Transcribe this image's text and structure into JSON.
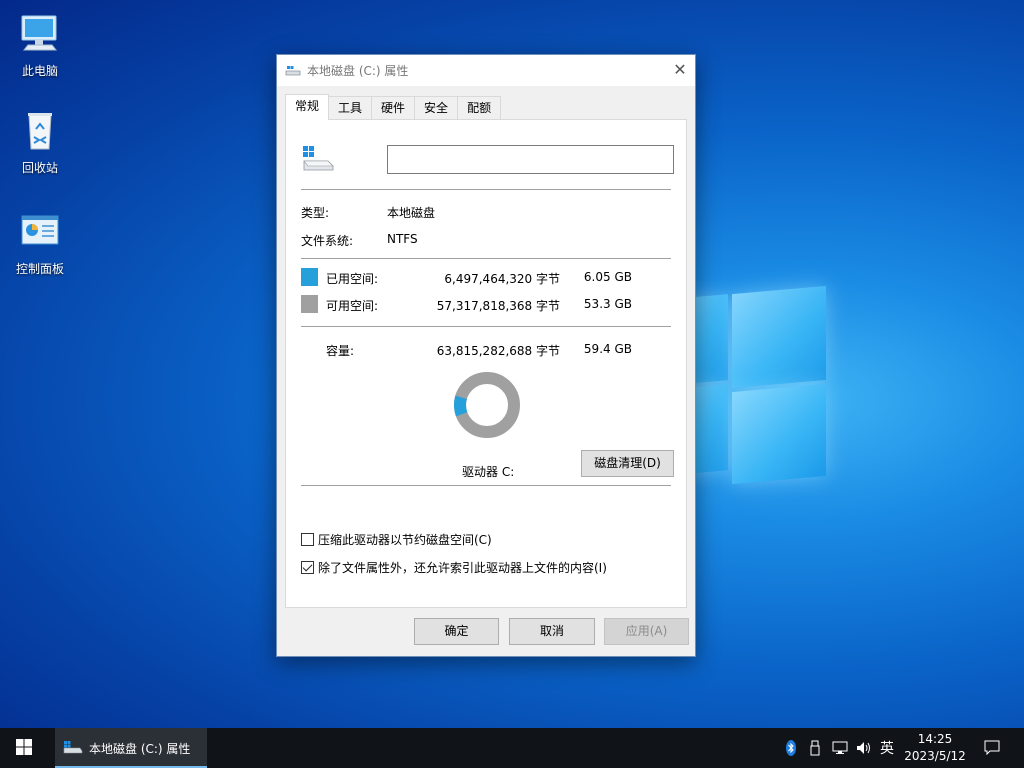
{
  "desktop": {
    "icons": [
      {
        "label": "此电脑",
        "icon": "computer-icon"
      },
      {
        "label": "回收站",
        "icon": "recycle-bin-icon"
      },
      {
        "label": "控制面板",
        "icon": "control-panel-icon"
      }
    ]
  },
  "dialog": {
    "title": "本地磁盘 (C:) 属性",
    "close_glyph": "✕",
    "tabs": [
      "常规",
      "工具",
      "硬件",
      "安全",
      "配额"
    ],
    "active_tab": "常规",
    "name_value": "",
    "type_label": "类型:",
    "type_value": "本地磁盘",
    "fs_label": "文件系统:",
    "fs_value": "NTFS",
    "used": {
      "label": "已用空间:",
      "bytes": "6,497,464,320 字节",
      "size": "6.05 GB",
      "color": "#26a0da"
    },
    "free": {
      "label": "可用空间:",
      "bytes": "57,317,818,368 字节",
      "size": "53.3 GB",
      "color": "#a0a0a0"
    },
    "capacity": {
      "label": "容量:",
      "bytes": "63,815,282,688 字节",
      "size": "59.4 GB"
    },
    "used_fraction": 0.102,
    "drive_label": "驱动器 C:",
    "cleanup_button": "磁盘清理(D)",
    "compress_checkbox": {
      "label": "压缩此驱动器以节约磁盘空间(C)",
      "checked": false
    },
    "index_checkbox": {
      "label": "除了文件属性外，还允许索引此驱动器上文件的内容(I)",
      "checked": true
    },
    "ok_button": "确定",
    "cancel_button": "取消",
    "apply_button": "应用(A)"
  },
  "taskbar": {
    "app_label": "本地磁盘 (C:) 属性",
    "tray_icons": [
      "bluetooth-icon",
      "usb-icon",
      "network-icon",
      "volume-icon"
    ],
    "ime": "英",
    "time": "14:25",
    "date": "2023/5/12"
  }
}
